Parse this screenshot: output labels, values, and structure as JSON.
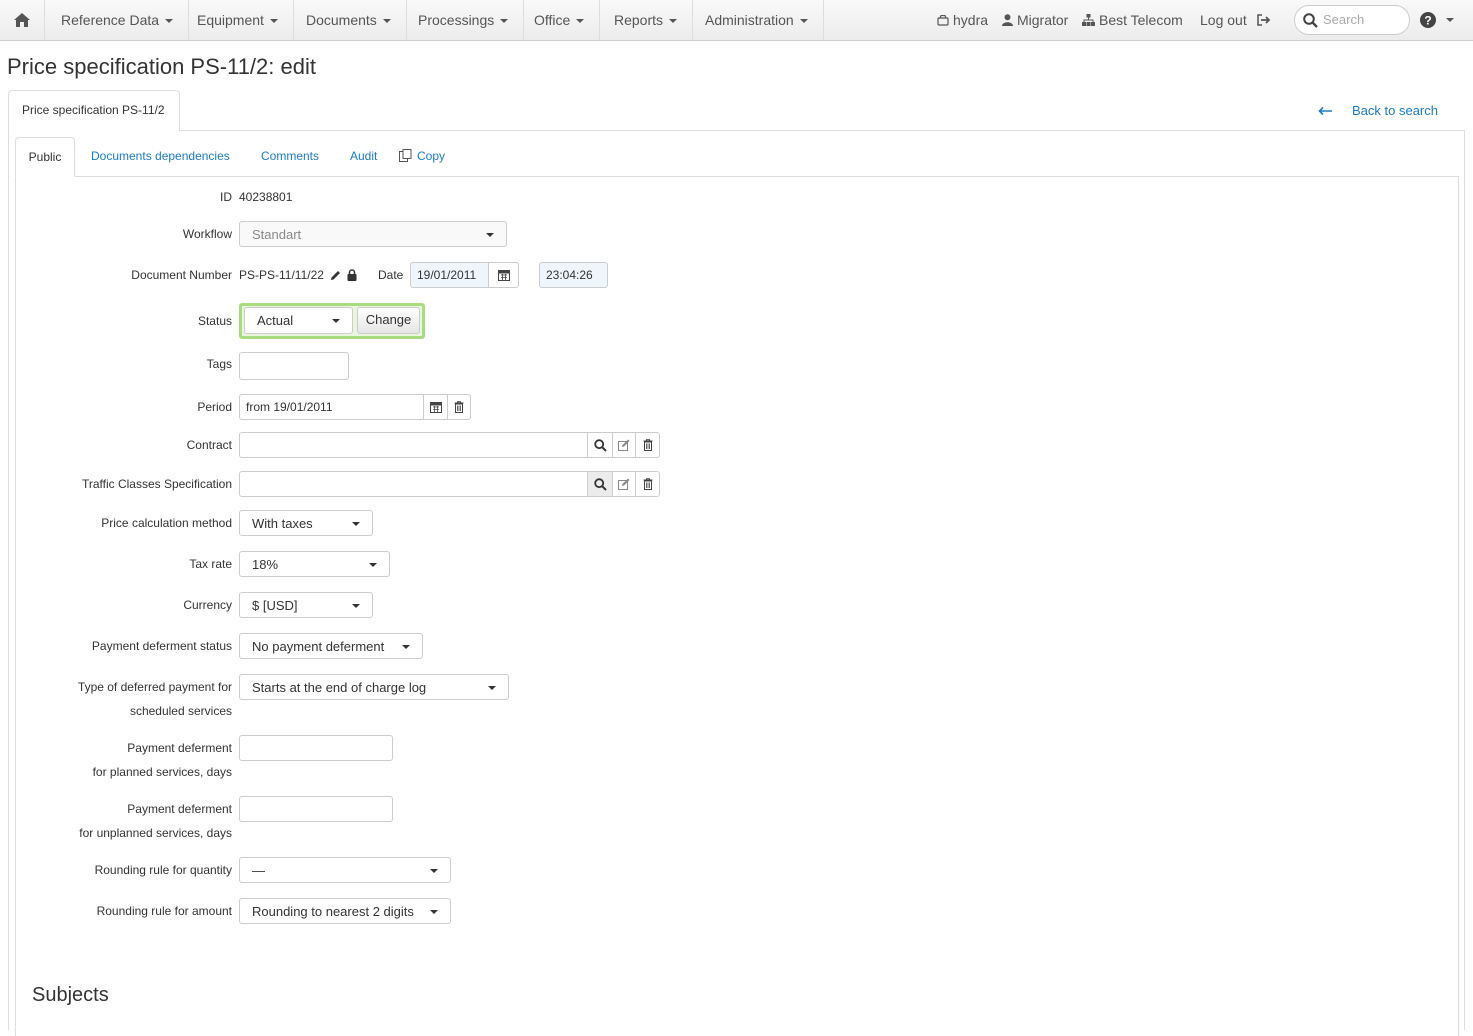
{
  "navbar": {
    "menu": [
      {
        "label": "Reference Data"
      },
      {
        "label": "Equipment"
      },
      {
        "label": "Documents"
      },
      {
        "label": "Processings"
      },
      {
        "label": "Office"
      },
      {
        "label": "Reports"
      },
      {
        "label": "Administration"
      }
    ],
    "db_label": "hydra",
    "user_label": "Migrator",
    "company_label": "Best Telecom",
    "logout_label": "Log out",
    "search_placeholder": "Search"
  },
  "page": {
    "title": "Price specification PS-11/2: edit",
    "outer_tab": "Price specification PS-11/2",
    "back_label": "Back to search",
    "tabs": [
      "Public",
      "Documents dependencies",
      "Comments",
      "Audit",
      "Copy"
    ]
  },
  "form": {
    "id_label": "ID",
    "id_value": "40238801",
    "workflow_label": "Workflow",
    "workflow_value": "Standart",
    "doc_number_label": "Document Number",
    "doc_number_value": "PS-PS-11/11/22",
    "date_label": "Date",
    "date_value": "19/01/2011",
    "time_value": "23:04:26",
    "status_label": "Status",
    "status_value": "Actual",
    "status_change": "Change",
    "tags_label": "Tags",
    "period_label": "Period",
    "period_value": "from 19/01/2011",
    "contract_label": "Contract",
    "traffic_label": "Traffic Classes Specification",
    "price_method_label": "Price calculation method",
    "price_method_value": "With taxes",
    "tax_rate_label": "Tax rate",
    "tax_rate_value": "18%",
    "currency_label": "Currency",
    "currency_value": "$ [USD]",
    "deferment_status_label": "Payment deferment status",
    "deferment_status_value": "No payment deferment",
    "deferred_type_label_1": "Type of deferred payment for",
    "deferred_type_label_2": "scheduled services",
    "deferred_type_value": "Starts at the end of charge log",
    "planned_label_1": "Payment deferment",
    "planned_label_2": "for planned services, days",
    "unplanned_label_1": "Payment deferment",
    "unplanned_label_2": "for unplanned services, days",
    "round_qty_label": "Rounding rule for quantity",
    "round_qty_value": "—",
    "round_amount_label": "Rounding rule for amount",
    "round_amount_value": "Rounding to nearest 2 digits"
  },
  "subjects_title": "Subjects"
}
